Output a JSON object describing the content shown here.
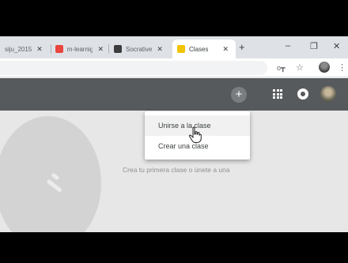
{
  "browser": {
    "tabs": [
      {
        "label": "siju_2015",
        "favicon_color": "#bfc2c7"
      },
      {
        "label": "m-learnig",
        "favicon_color": "#e8453c"
      },
      {
        "label": "Socrative",
        "favicon_color": "#3c3c3c"
      },
      {
        "label": "Clases",
        "favicon_color": "#f2c300",
        "active": true
      }
    ],
    "new_tab_symbol": "+",
    "window_controls": {
      "minimize": "–",
      "maximize": "❐",
      "close": "✕"
    },
    "toolbar_icons": {
      "key": "key-icon",
      "star": "star-icon",
      "menu": "menu-dots-icon"
    }
  },
  "app": {
    "bar_color": "#575a5d",
    "add_button_symbol": "+",
    "icons": [
      "apps-grid-icon",
      "notifications-icon",
      "profile-avatar"
    ]
  },
  "menu": {
    "items": [
      {
        "label": "Unirse a la clase"
      },
      {
        "label": "Crear una clase"
      }
    ]
  },
  "content": {
    "empty_message": "Crea tu primera clase o únete a una"
  }
}
